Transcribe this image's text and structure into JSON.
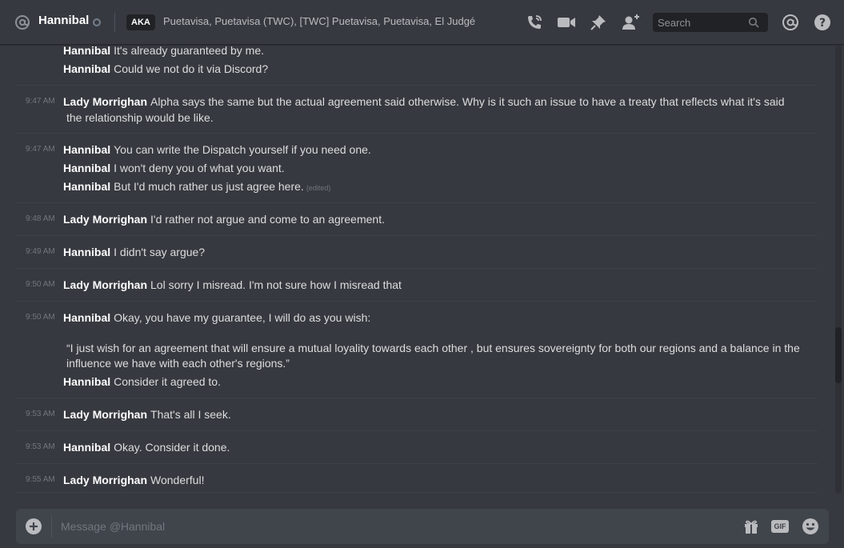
{
  "header": {
    "title": "Hannibal",
    "aka_label": "AKA",
    "aka_names": "Puetavisa, Puetavisa (TWC), [TWC] Puetavisa, Puetavisa, El Judgé",
    "search_placeholder": "Search"
  },
  "icons": {
    "dm": "at-icon",
    "status": "status-offline-icon",
    "call": "phone-call-icon",
    "video": "video-camera-icon",
    "pin": "pin-icon",
    "add_friend": "add-friend-icon",
    "search": "search-icon",
    "mentions": "at-icon",
    "help": "help-icon",
    "upload": "plus-icon",
    "gift": "gift-icon",
    "gif": "gif-icon",
    "emoji": "emoji-icon"
  },
  "colors": {
    "background": "#36393f",
    "author": "#ffffff",
    "text": "#dcddde",
    "timestamp": "#72767d",
    "composer": "#40444b"
  },
  "messages": {
    "g0": {
      "lines": [
        {
          "author": "Hannibal",
          "text": "It's already guaranteed by me."
        },
        {
          "author": "Hannibal",
          "text": "Could we not do it via Discord?"
        }
      ]
    },
    "g1": {
      "time": "9:47 AM",
      "author": "Lady Morrighan",
      "text": "Alpha says the same but the actual agreement said otherwise. Why is it such an issue to have a treaty that reflects what it's said",
      "text2": "the relationship would be like."
    },
    "g2": {
      "time": "9:47 AM",
      "lines": [
        {
          "author": "Hannibal",
          "text": "You can write the Dispatch yourself if you need one."
        },
        {
          "author": "Hannibal",
          "text": "I won't deny you of what you want."
        },
        {
          "author": "Hannibal",
          "text": "But I'd much rather us just agree here.",
          "edited": "(edited)"
        }
      ]
    },
    "g3": {
      "time": "9:48 AM",
      "author": "Lady Morrighan",
      "text": "I'd rather not argue and come to an agreement."
    },
    "g4": {
      "time": "9:49 AM",
      "author": "Hannibal",
      "text": "I didn't say argue?"
    },
    "g5": {
      "time": "9:50 AM",
      "author": "Lady Morrighan",
      "text": "Lol sorry I misread. I'm not sure how I misread that"
    },
    "g6": {
      "time": "9:50 AM",
      "author": "Hannibal",
      "text": "Okay, you have my guarantee, I will do as you wish:",
      "quote": "“I just wish for an agreement that will ensure a mutual loyality towards each other , but ensures sovereignty for both our regions and a balance in the influence we have with each other's regions.”",
      "author2": "Hannibal",
      "text2": "Consider it agreed to."
    },
    "g7": {
      "time": "9:53 AM",
      "author": "Lady Morrighan",
      "text": "That's all I seek."
    },
    "g8": {
      "time": "9:53 AM",
      "author": "Hannibal",
      "text": "Okay. Consider it done."
    },
    "g9": {
      "time": "9:55 AM",
      "author": "Lady Morrighan",
      "text": "Wonderful!"
    }
  },
  "composer": {
    "placeholder": "Message @Hannibal",
    "gif_label": "GIF"
  }
}
